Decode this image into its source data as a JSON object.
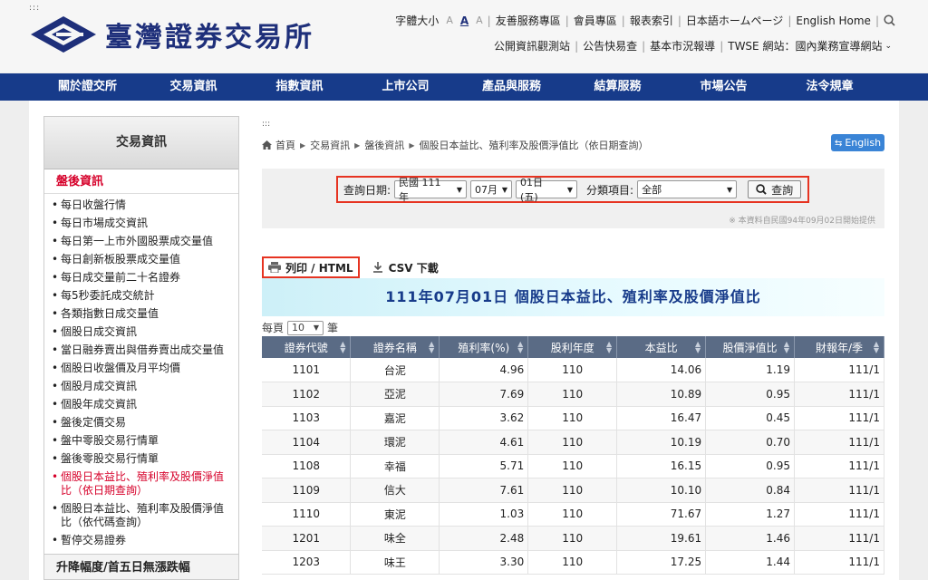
{
  "header": {
    "skip_text": ":::",
    "logo_text": "臺灣證券交易所",
    "font_label": "字體大小",
    "font_sizes": [
      "A",
      "A",
      "A"
    ],
    "top_links": [
      "友善服務專區",
      "會員專區",
      "報表索引",
      "日本語ホームページ",
      "English Home"
    ],
    "top_links2": [
      "公開資訊觀測站",
      "公告快易查",
      "基本市況報導",
      "TWSE 網站：國內業務宣導網站"
    ]
  },
  "nav": [
    "關於證交所",
    "交易資訊",
    "指數資訊",
    "上市公司",
    "產品與服務",
    "結算服務",
    "市場公告",
    "法令規章"
  ],
  "sidebar": {
    "title": "交易資訊",
    "section": "盤後資訊",
    "items": [
      "每日收盤行情",
      "每日市場成交資訊",
      "每日第一上市外國股票成交量值",
      "每日創新板股票成交量值",
      "每日成交量前二十名證券",
      "每5秒委託成交統計",
      "各類指數日成交量值",
      "個股日成交資訊",
      "當日融券賣出與借券賣出成交量值",
      "個股日收盤價及月平均價",
      "個股月成交資訊",
      "個股年成交資訊",
      "盤後定價交易",
      "盤中零股交易行情單",
      "盤後零股交易行情單",
      "個股日本益比、殖利率及股價淨值比（依日期查詢）",
      "個股日本益比、殖利率及股價淨值比（依代碼查詢）",
      "暫停交易證券"
    ],
    "active_index": 15,
    "footer": "升降幅度/首五日無漲跌幅"
  },
  "main": {
    "skip_text": ":::",
    "breadcrumb": [
      "首頁",
      "交易資訊",
      "盤後資訊",
      "個股日本益比、殖利率及股價淨值比（依日期查詢）"
    ],
    "english_button": "English",
    "query": {
      "label_date": "查詢日期:",
      "year": "民國 111 年",
      "month": "07月",
      "day": "01日 (五)",
      "label_category": "分類項目:",
      "category": "全部",
      "button": "查詢",
      "note": "※ 本資料自民國94年09月02日開始提供"
    },
    "print_button": "列印 / HTML",
    "csv_button": "CSV 下載",
    "report_title": "111年07月01日 個股日本益比、殖利率及股價淨值比",
    "per_page_label": "每頁",
    "per_page_value": "10",
    "per_page_unit": "筆",
    "table": {
      "columns": [
        "證券代號",
        "證券名稱",
        "殖利率(%)",
        "股利年度",
        "本益比",
        "股價淨值比",
        "財報年/季"
      ],
      "rows": [
        [
          "1101",
          "台泥",
          "4.96",
          "110",
          "14.06",
          "1.19",
          "111/1"
        ],
        [
          "1102",
          "亞泥",
          "7.69",
          "110",
          "10.89",
          "0.95",
          "111/1"
        ],
        [
          "1103",
          "嘉泥",
          "3.62",
          "110",
          "16.47",
          "0.45",
          "111/1"
        ],
        [
          "1104",
          "環泥",
          "4.61",
          "110",
          "10.19",
          "0.70",
          "111/1"
        ],
        [
          "1108",
          "幸福",
          "5.71",
          "110",
          "16.15",
          "0.95",
          "111/1"
        ],
        [
          "1109",
          "信大",
          "7.61",
          "110",
          "10.10",
          "0.84",
          "111/1"
        ],
        [
          "1110",
          "東泥",
          "1.03",
          "110",
          "71.67",
          "1.27",
          "111/1"
        ],
        [
          "1201",
          "味全",
          "2.48",
          "110",
          "19.61",
          "1.46",
          "111/1"
        ],
        [
          "1203",
          "味王",
          "3.30",
          "110",
          "17.25",
          "1.44",
          "111/1"
        ]
      ]
    }
  }
}
